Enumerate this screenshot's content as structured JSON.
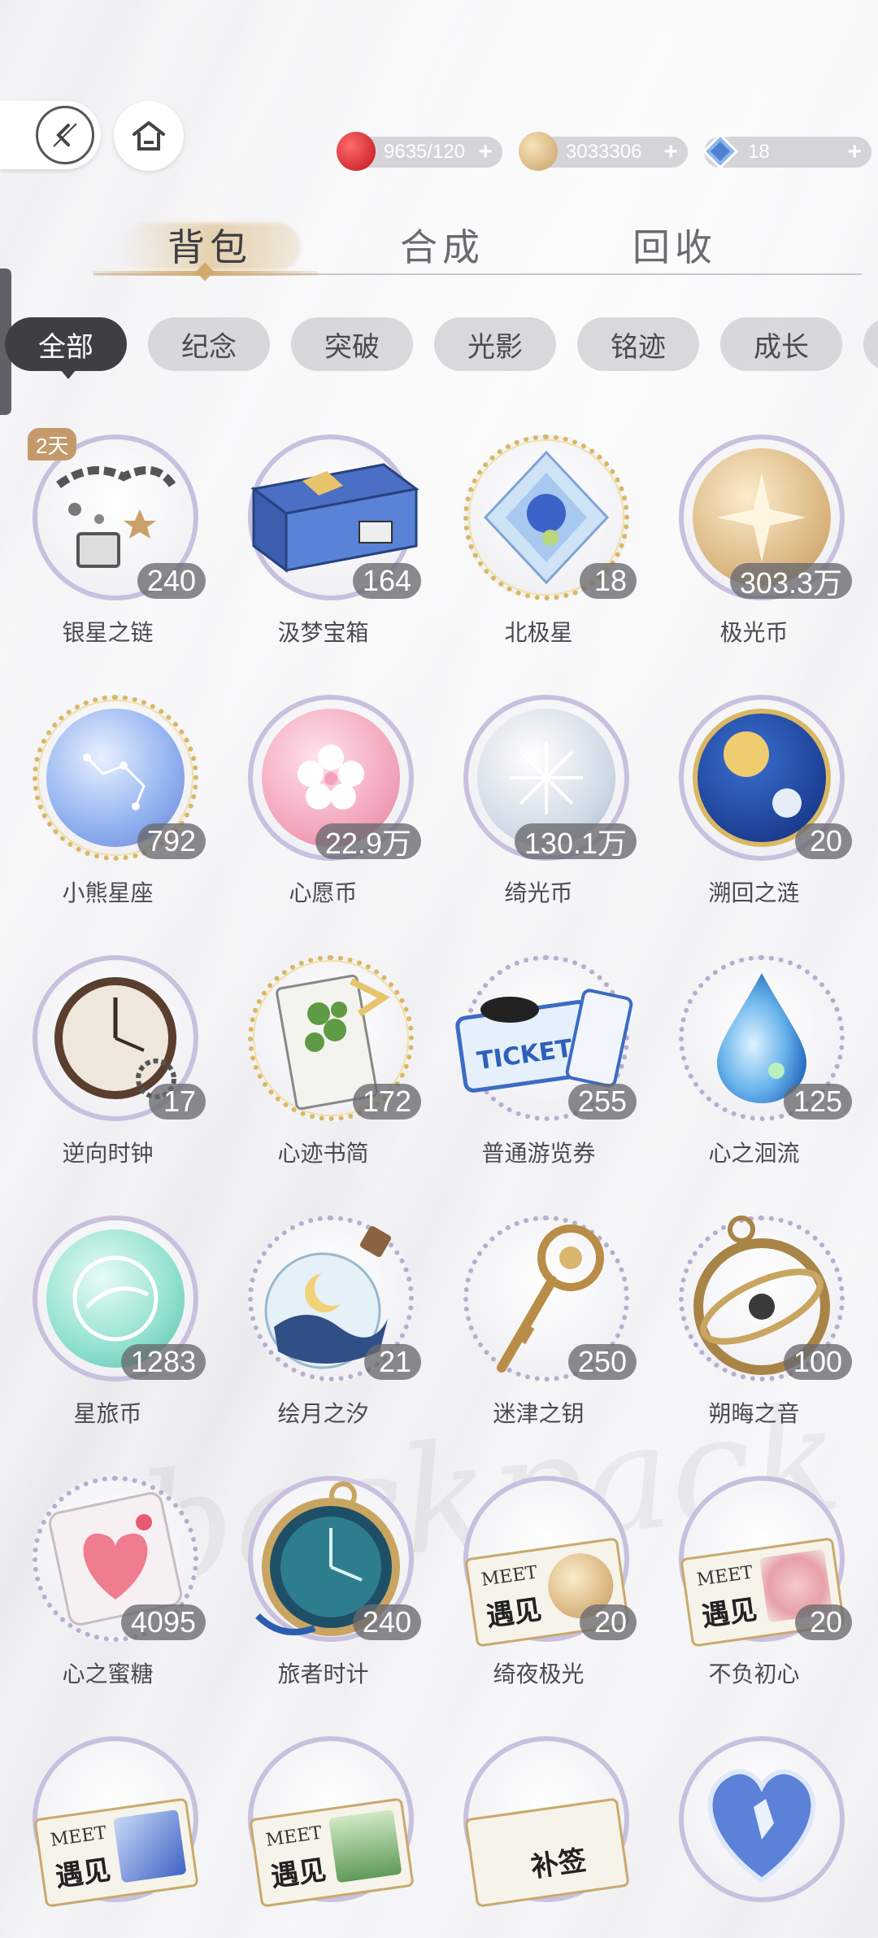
{
  "header": {
    "back_icon": "back-arrow-icon",
    "home_icon": "home-icon"
  },
  "currencies": [
    {
      "name": "stamina",
      "value": "9635/120",
      "icon": "red-apple-icon",
      "color": "#d8262c"
    },
    {
      "name": "coins",
      "value": "3033306",
      "icon": "gold-coin-icon",
      "color": "#d9b77c"
    },
    {
      "name": "diamonds",
      "value": "18",
      "icon": "blue-diamond-icon",
      "color": "#6f9ee0"
    }
  ],
  "main_tabs": [
    {
      "label": "背包",
      "active": true
    },
    {
      "label": "合成",
      "active": false
    },
    {
      "label": "回收",
      "active": false
    }
  ],
  "filters": [
    {
      "label": "全部",
      "active": true
    },
    {
      "label": "纪念",
      "active": false
    },
    {
      "label": "突破",
      "active": false
    },
    {
      "label": "光影",
      "active": false
    },
    {
      "label": "铭迹",
      "active": false
    },
    {
      "label": "成长",
      "active": false
    }
  ],
  "items": [
    {
      "name": "银星之链",
      "count": "240",
      "badge": "2天",
      "icon": "silver-star-chain-icon"
    },
    {
      "name": "汲梦宝箱",
      "count": "164",
      "icon": "dream-treasure-box-icon"
    },
    {
      "name": "北极星",
      "count": "18",
      "icon": "polaris-crystal-icon"
    },
    {
      "name": "极光币",
      "count": "303.3万",
      "icon": "aurora-coin-icon"
    },
    {
      "name": "小熊星座",
      "count": "792",
      "icon": "ursa-minor-coin-icon"
    },
    {
      "name": "心愿币",
      "count": "22.9万",
      "icon": "wish-coin-icon"
    },
    {
      "name": "绮光币",
      "count": "130.1万",
      "icon": "radiance-coin-icon"
    },
    {
      "name": "溯回之涟",
      "count": "20",
      "icon": "sun-moon-orb-icon"
    },
    {
      "name": "逆向时钟",
      "count": "17",
      "icon": "reverse-clock-icon"
    },
    {
      "name": "心迹书简",
      "count": "172",
      "icon": "heart-letter-icon"
    },
    {
      "name": "普通游览券",
      "count": "255",
      "icon": "tour-ticket-icon"
    },
    {
      "name": "心之洄流",
      "count": "125",
      "icon": "water-drop-icon"
    },
    {
      "name": "星旅币",
      "count": "1283",
      "icon": "star-travel-coin-icon"
    },
    {
      "name": "绘月之汐",
      "count": "21",
      "icon": "moon-bottle-icon"
    },
    {
      "name": "迷津之钥",
      "count": "250",
      "icon": "golden-key-icon"
    },
    {
      "name": "朔晦之音",
      "count": "100",
      "icon": "armillary-sphere-icon"
    },
    {
      "name": "心之蜜糖",
      "count": "4095",
      "icon": "heart-candy-icon"
    },
    {
      "name": "旅者时计",
      "count": "240",
      "icon": "pocket-watch-icon"
    },
    {
      "name": "绮夜极光",
      "count": "20",
      "icon": "meet-ticket-coin-icon"
    },
    {
      "name": "不负初心",
      "count": "20",
      "icon": "meet-ticket-flower-icon"
    }
  ],
  "partial_items": [
    {
      "icon": "meet-ticket-crystal-icon"
    },
    {
      "icon": "meet-ticket-forest-icon"
    },
    {
      "icon": "makeup-ticket-icon",
      "label": "补签"
    },
    {
      "icon": "heart-crystal-icon"
    }
  ],
  "ticket_text": {
    "meet": "MEET",
    "yujian": "遇见",
    "ticket": "TICKET"
  }
}
